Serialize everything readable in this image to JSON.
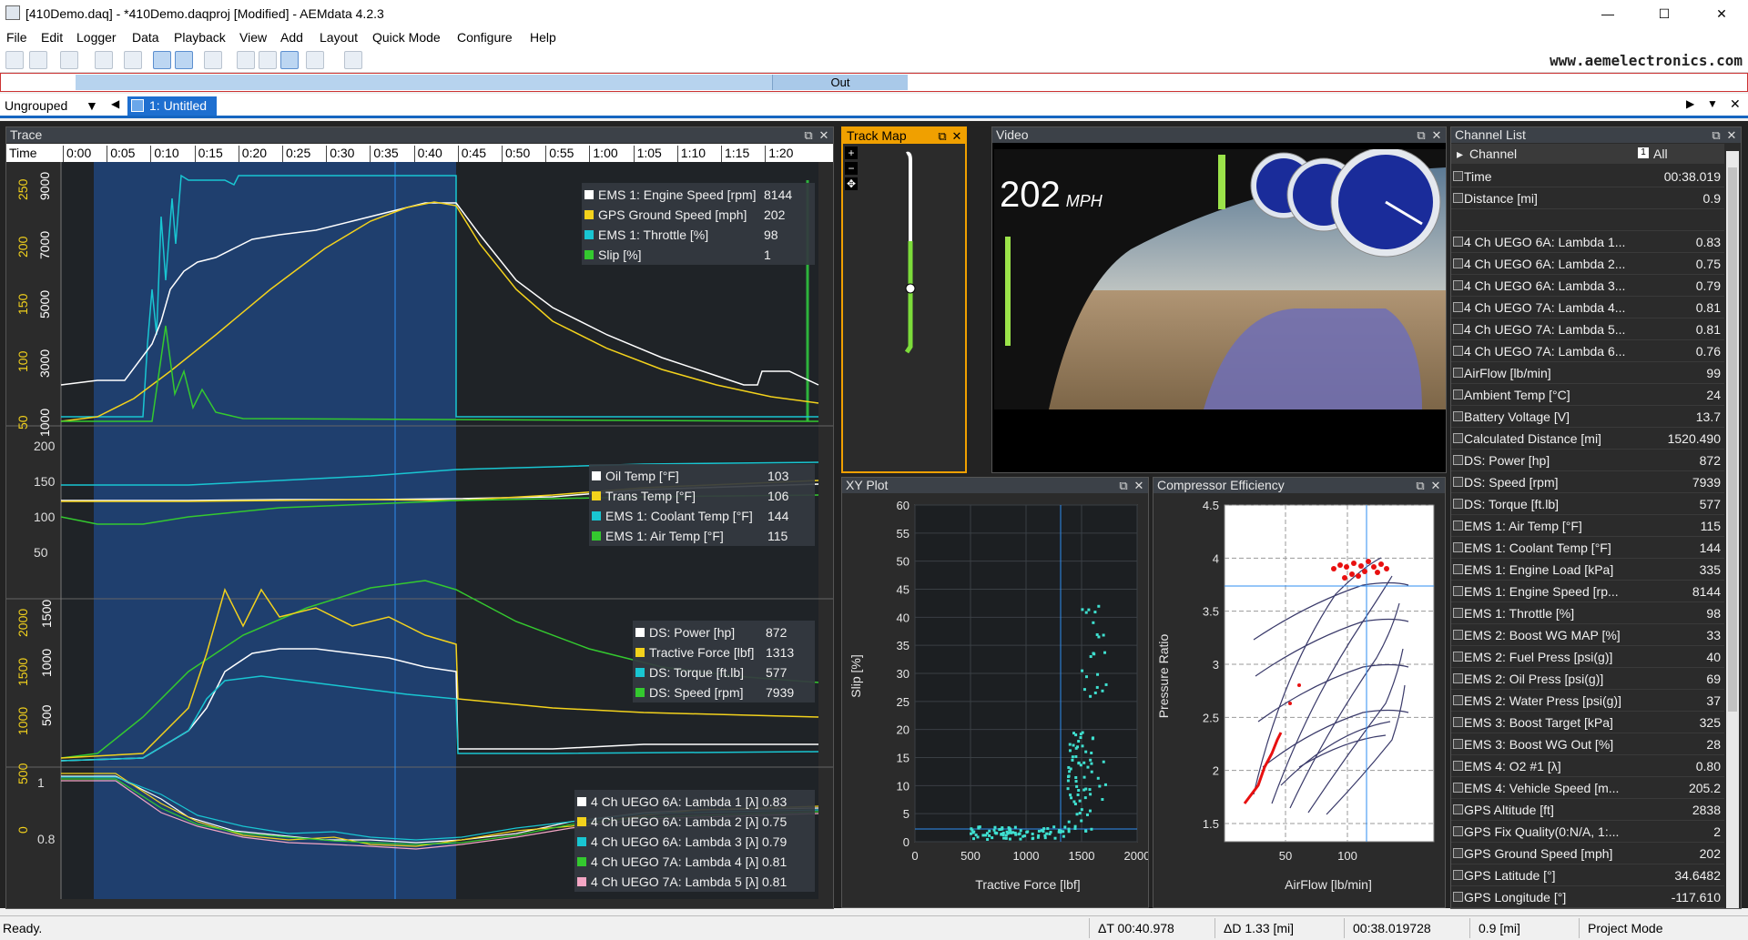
{
  "titlebar": {
    "title": "[410Demo.daq] - *410Demo.daqproj [Modified] - AEMdata 4.2.3",
    "minimize": "—",
    "maximize": "☐",
    "close": "✕"
  },
  "menu": [
    "File",
    "Edit",
    "Logger",
    "Data",
    "Playback",
    "View",
    "Add",
    "Layout",
    "Quick Mode",
    "Configure",
    "Help"
  ],
  "website": "www.aemelectronics.com",
  "timeline": {
    "out_label": "Out"
  },
  "tabs": {
    "group": "Ungrouped",
    "doc_tab": "1: Untitled"
  },
  "trace": {
    "title": "Trace",
    "time_label": "Time",
    "time_ticks": [
      "0:00",
      "0:05",
      "0:10",
      "0:15",
      "0:20",
      "0:25",
      "0:30",
      "0:35",
      "0:40",
      "0:45",
      "0:50",
      "0:55",
      "1:00",
      "1:05",
      "1:10",
      "1:15",
      "1:20"
    ],
    "pane1": {
      "yticks_rpm": [
        "9000",
        "7000",
        "5000",
        "3000",
        "1000"
      ],
      "yticks_mph": [
        "250",
        "200",
        "150",
        "100",
        "50"
      ],
      "legend": [
        {
          "name": "EMS 1: Engine Speed [rpm]",
          "value": "8144",
          "color": "#ffffff"
        },
        {
          "name": "GPS Ground Speed [mph]",
          "value": "202",
          "color": "#f3d21c"
        },
        {
          "name": "EMS 1: Throttle [%]",
          "value": "98",
          "color": "#19c6d2"
        },
        {
          "name": "Slip [%]",
          "value": "1",
          "color": "#34c92f"
        }
      ]
    },
    "pane2": {
      "yticks": [
        "200",
        "150",
        "100",
        "50"
      ],
      "legend": [
        {
          "name": "Oil Temp [°F]",
          "value": "103",
          "color": "#ffffff"
        },
        {
          "name": "Trans Temp [°F]",
          "value": "106",
          "color": "#f3d21c"
        },
        {
          "name": "EMS 1: Coolant Temp [°F]",
          "value": "144",
          "color": "#19c6d2"
        },
        {
          "name": "EMS 1: Air Temp [°F]",
          "value": "115",
          "color": "#34c92f"
        }
      ]
    },
    "pane3": {
      "yticks_a": [
        "2000",
        "1500",
        "1000",
        "500",
        "0"
      ],
      "yticks_b": [
        "1500",
        "1000",
        "500"
      ],
      "legend": [
        {
          "name": "DS: Power [hp]",
          "value": "872",
          "color": "#ffffff"
        },
        {
          "name": "Tractive Force [lbf]",
          "value": "1313",
          "color": "#f3d21c"
        },
        {
          "name": "DS: Torque [ft.lb]",
          "value": "577",
          "color": "#19c6d2"
        },
        {
          "name": "DS: Speed [rpm]",
          "value": "7939",
          "color": "#34c92f"
        }
      ]
    },
    "pane4": {
      "yticks": [
        "1",
        "0.8"
      ],
      "legend": [
        {
          "name": "4 Ch UEGO 6A: Lambda 1 [λ]",
          "value": "0.83",
          "color": "#ffffff"
        },
        {
          "name": "4 Ch UEGO 6A: Lambda 2 [λ]",
          "value": "0.75",
          "color": "#f3d21c"
        },
        {
          "name": "4 Ch UEGO 6A: Lambda 3 [λ]",
          "value": "0.79",
          "color": "#19c6d2"
        },
        {
          "name": "4 Ch UEGO 7A: Lambda 4 [λ]",
          "value": "0.81",
          "color": "#34c92f"
        },
        {
          "name": "4 Ch UEGO 7A: Lambda 5 [λ]",
          "value": "0.81",
          "color": "#f4a6c4"
        }
      ]
    }
  },
  "trackmap": {
    "title": "Track Map",
    "tools": [
      "+",
      "−",
      "✥"
    ]
  },
  "video": {
    "title": "Video",
    "speed": "202",
    "unit": "MPH"
  },
  "xyplot": {
    "title": "XY Plot",
    "ylabel": "Slip [%]",
    "xlabel": "Tractive Force [lbf]",
    "yticks": [
      "60",
      "55",
      "50",
      "45",
      "40",
      "35",
      "30",
      "25",
      "20",
      "15",
      "10",
      "5",
      "0"
    ],
    "xticks": [
      "0",
      "500",
      "1000",
      "1500",
      "2000"
    ]
  },
  "compressor": {
    "title": "Compressor Efficiency",
    "ylabel": "Pressure Ratio",
    "xlabel": "AirFlow [lb/min]",
    "yticks": [
      "4.5",
      "4",
      "3.5",
      "3",
      "2.5",
      "2",
      "1.5"
    ],
    "xticks": [
      "50",
      "100"
    ]
  },
  "channels": {
    "title": "Channel List",
    "col_channel": "Channel",
    "col_all": "All",
    "items": [
      {
        "name": "Time",
        "value": "00:38.019"
      },
      {
        "name": "Distance [mi]",
        "value": "0.9"
      },
      {
        "name": "",
        "value": ""
      },
      {
        "name": "4 Ch UEGO 6A: Lambda 1...",
        "value": "0.83"
      },
      {
        "name": "4 Ch UEGO 6A: Lambda 2...",
        "value": "0.75"
      },
      {
        "name": "4 Ch UEGO 6A: Lambda 3...",
        "value": "0.79"
      },
      {
        "name": "4 Ch UEGO 7A: Lambda 4...",
        "value": "0.81"
      },
      {
        "name": "4 Ch UEGO 7A: Lambda 5...",
        "value": "0.81"
      },
      {
        "name": "4 Ch UEGO 7A: Lambda 6...",
        "value": "0.76"
      },
      {
        "name": "AirFlow [lb/min]",
        "value": "99"
      },
      {
        "name": "Ambient Temp [°C]",
        "value": "24"
      },
      {
        "name": "Battery Voltage [V]",
        "value": "13.7"
      },
      {
        "name": "Calculated Distance [mi]",
        "value": "1520.490"
      },
      {
        "name": "DS: Power [hp]",
        "value": "872"
      },
      {
        "name": "DS: Speed [rpm]",
        "value": "7939"
      },
      {
        "name": "DS: Torque [ft.lb]",
        "value": "577"
      },
      {
        "name": "EMS 1: Air Temp [°F]",
        "value": "115"
      },
      {
        "name": "EMS 1: Coolant Temp [°F]",
        "value": "144"
      },
      {
        "name": "EMS 1: Engine Load [kPa]",
        "value": "335"
      },
      {
        "name": "EMS 1: Engine Speed [rp...",
        "value": "8144"
      },
      {
        "name": "EMS 1: Throttle [%]",
        "value": "98"
      },
      {
        "name": "EMS 2: Boost WG MAP [%]",
        "value": "33"
      },
      {
        "name": "EMS 2: Fuel Press [psi(g)]",
        "value": "40"
      },
      {
        "name": "EMS 2: Oil Press [psi(g)]",
        "value": "69"
      },
      {
        "name": "EMS 2: Water Press [psi(g)]",
        "value": "37"
      },
      {
        "name": "EMS 3: Boost Target [kPa]",
        "value": "325"
      },
      {
        "name": "EMS 3: Boost WG Out [%]",
        "value": "28"
      },
      {
        "name": "EMS 4: O2 #1 [λ]",
        "value": "0.80"
      },
      {
        "name": "EMS 4: Vehicle Speed [m...",
        "value": "205.2"
      },
      {
        "name": "GPS Altitude [ft]",
        "value": "2838"
      },
      {
        "name": "GPS Fix Quality(0:N/A, 1:...",
        "value": "2"
      },
      {
        "name": "GPS Ground Speed [mph]",
        "value": "202"
      },
      {
        "name": "GPS Latitude [°]",
        "value": "34.6482"
      },
      {
        "name": "GPS Longitude [°]",
        "value": "-117.610"
      }
    ]
  },
  "status": {
    "ready": "Ready.",
    "delta_t": "ΔT 00:40.978",
    "delta_d": "ΔD 1.33 [mi]",
    "time": "00:38.019728",
    "dist": "0.9 [mi]",
    "mode": "Project Mode"
  }
}
